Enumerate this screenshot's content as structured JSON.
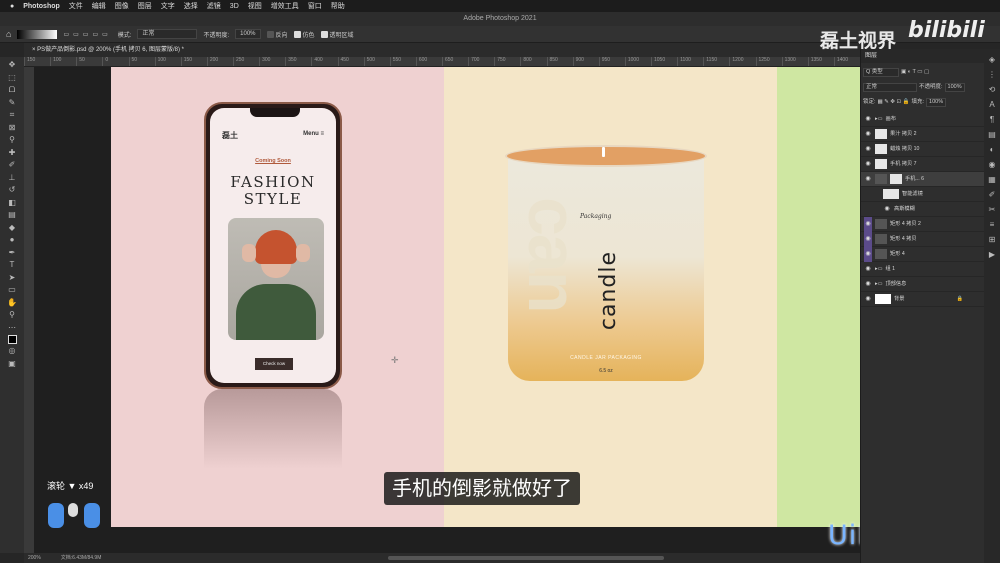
{
  "menubar": {
    "app": "Photoshop",
    "items": [
      "文件",
      "编辑",
      "图像",
      "图层",
      "文字",
      "选择",
      "滤镜",
      "3D",
      "视图",
      "增效工具",
      "窗口",
      "帮助"
    ]
  },
  "window_title": "Adobe Photoshop 2021",
  "options": {
    "mode_label": "模式:",
    "mode_value": "正常",
    "opacity_label": "不透明度:",
    "opacity_value": "100%",
    "reverse": "反向",
    "dither": "仿色",
    "transparency": "透明区域"
  },
  "tab": "PS做产品倒影.psd @ 200% (手机 拷贝 6, 图层蒙版/8) *",
  "ruler_ticks": [
    "150",
    "100",
    "50",
    "0",
    "50",
    "100",
    "150",
    "200",
    "250",
    "300",
    "350",
    "400",
    "450",
    "500",
    "550",
    "600",
    "650",
    "700",
    "750",
    "800",
    "850",
    "900",
    "950",
    "1000",
    "1050",
    "1100",
    "1150",
    "1200",
    "1250",
    "1300",
    "1350",
    "1400"
  ],
  "phone": {
    "brand": "磊土",
    "menu": "Menu ≡",
    "coming": "Coming Soon",
    "fashion": "FASHION\nSTYLE",
    "button": "Check now"
  },
  "candle": {
    "script": "Packaging",
    "big": "can",
    "vertical": "candle",
    "packaging": "CANDLE JAR PACKAGING",
    "oz": "6.5 oz"
  },
  "subtitle": "手机的倒影就做好了",
  "scroll_hint": "滚轮 ▼ x49",
  "watermarks": {
    "logo": "磊土视界",
    "bili": "bilibili",
    "uibq": "UiBQ.CoM"
  },
  "status": {
    "zoom": "200%",
    "doc": "文档:6.43M/84.9M"
  },
  "panel": {
    "title": "图层",
    "kind": "Q 类型",
    "blend": "正常",
    "opacity_label": "不透明度:",
    "opacity": "100%",
    "lock_label": "锁定:",
    "fill_label": "填充:",
    "fill": "100%",
    "layers": [
      {
        "name": "画布",
        "type": "group"
      },
      {
        "name": "果汁 拷贝 2",
        "type": "layer"
      },
      {
        "name": "蜡烛 拷贝 10",
        "type": "layer"
      },
      {
        "name": "手机 拷贝 7",
        "type": "layer"
      },
      {
        "name": "手机... 6",
        "type": "layer",
        "selected": true
      },
      {
        "name": "智能滤镜",
        "type": "filter"
      },
      {
        "name": "高斯模糊",
        "type": "filter"
      },
      {
        "name": "矩形 4 拷贝 2",
        "type": "layer",
        "purple": true
      },
      {
        "name": "矩形 4 拷贝",
        "type": "layer",
        "purple": true
      },
      {
        "name": "矩形 4",
        "type": "layer",
        "purple": true
      },
      {
        "name": "组 1",
        "type": "group"
      },
      {
        "name": "顶部信息",
        "type": "group"
      },
      {
        "name": "背景",
        "type": "layer"
      }
    ]
  },
  "colors": {
    "pink": "#efd1d1",
    "cream": "#f4e6c8",
    "green": "#cfe7a2",
    "accent": "#4a8fe6"
  }
}
